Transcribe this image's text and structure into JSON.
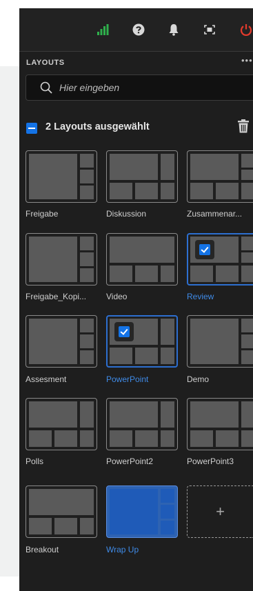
{
  "colors": {
    "accent": "#1473e6",
    "selected_label": "#3f8ae6",
    "panel_bg": "#1e1e1e",
    "signal_green": "#2fb04c",
    "power_red": "#e53b2c"
  },
  "toolbar": {
    "icons": [
      "signal-bars-icon",
      "help-icon",
      "bell-icon",
      "fullscreen-icon",
      "power-icon"
    ]
  },
  "layouts_panel": {
    "title": "LAYOUTS",
    "more": "•••",
    "search_placeholder": "Hier eingeben",
    "selection_text": "2 Layouts ausgewählt",
    "tiles": [
      {
        "label": "Freigabe",
        "selected": false
      },
      {
        "label": "Diskussion",
        "selected": false
      },
      {
        "label": "Zusammenar...",
        "selected": false
      },
      {
        "label": "Freigabe_Kopi...",
        "selected": false
      },
      {
        "label": "Video",
        "selected": false
      },
      {
        "label": "Review",
        "selected": true
      },
      {
        "label": "Assesment",
        "selected": false
      },
      {
        "label": "PowerPoint",
        "selected": true
      },
      {
        "label": "Demo",
        "selected": false
      },
      {
        "label": "Polls",
        "selected": false
      },
      {
        "label": "PowerPoint2",
        "selected": false
      },
      {
        "label": "PowerPoint3",
        "selected": false
      },
      {
        "label": "Breakout",
        "selected": false
      },
      {
        "label": "Wrap Up",
        "selected": false
      }
    ],
    "add_label": "+"
  }
}
